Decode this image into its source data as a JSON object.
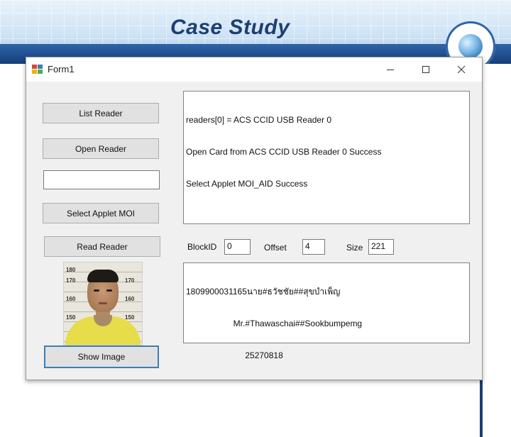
{
  "slide": {
    "title": "Case Study"
  },
  "window": {
    "title": "Form1",
    "controls": {
      "minimize_icon": "minimize-icon",
      "maximize_icon": "maximize-icon",
      "close_icon": "close-icon"
    }
  },
  "buttons": {
    "list_reader": "List Reader",
    "open_reader": "Open Reader",
    "select_applet": "Select Applet MOI",
    "read_reader": "Read Reader",
    "show_image": "Show Image"
  },
  "inputs": {
    "reader_name": "",
    "block_id_label": "BlockID",
    "block_id": "0",
    "offset_label": "Offset",
    "offset": "4",
    "size_label": "Size",
    "size": "221"
  },
  "log": {
    "lines": [
      "readers[0] = ACS CCID USB Reader 0",
      "Open Card from ACS CCID USB Reader 0 Success",
      "Select Applet MOI_AID Success"
    ]
  },
  "result": {
    "lines": [
      "1809900031165นาย#ธวัชชัย##สุขบำเพ็ญ",
      "                    Mr.#Thawaschai##Sookbumpemg",
      "                         25270818"
    ]
  },
  "photo": {
    "scale_labels": [
      "180",
      "170",
      "160",
      "150",
      "170",
      "160",
      "150"
    ]
  },
  "colors": {
    "header_dark": "#163f7a",
    "title_color": "#1c3f73",
    "focus_border": "#3c7fb1"
  }
}
